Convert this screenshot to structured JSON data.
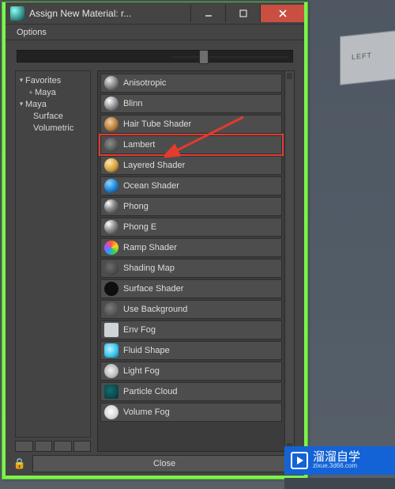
{
  "titlebar": {
    "title": "Assign New Material: r..."
  },
  "menubar": {
    "options": "Options"
  },
  "tree": {
    "favorites": "Favorites",
    "add_maya": "Maya",
    "maya": "Maya",
    "surface": "Surface",
    "volumetric": "Volumetric"
  },
  "materials": [
    {
      "id": "anisotropic",
      "label": "Anisotropic",
      "icon": "ico-aniso"
    },
    {
      "id": "blinn",
      "label": "Blinn",
      "icon": "ico-blinn"
    },
    {
      "id": "hair-tube-shader",
      "label": "Hair Tube Shader",
      "icon": "ico-hair"
    },
    {
      "id": "lambert",
      "label": "Lambert",
      "icon": "ico-lambert",
      "highlight": true
    },
    {
      "id": "layered-shader",
      "label": "Layered Shader",
      "icon": "ico-layer"
    },
    {
      "id": "ocean-shader",
      "label": "Ocean Shader",
      "icon": "ico-ocean"
    },
    {
      "id": "phong",
      "label": "Phong",
      "icon": "ico-phong"
    },
    {
      "id": "phong-e",
      "label": "Phong E",
      "icon": "ico-phonge"
    },
    {
      "id": "ramp-shader",
      "label": "Ramp Shader",
      "icon": "ico-ramp"
    },
    {
      "id": "shading-map",
      "label": "Shading Map",
      "icon": "ico-shmap"
    },
    {
      "id": "surface-shader",
      "label": "Surface Shader",
      "icon": "ico-surf"
    },
    {
      "id": "use-background",
      "label": "Use Background",
      "icon": "ico-usebg"
    },
    {
      "id": "env-fog",
      "label": "Env Fog",
      "icon": "ico-envfog"
    },
    {
      "id": "fluid-shape",
      "label": "Fluid Shape",
      "icon": "ico-fluid"
    },
    {
      "id": "light-fog",
      "label": "Light Fog",
      "icon": "ico-lightfog"
    },
    {
      "id": "particle-cloud",
      "label": "Particle Cloud",
      "icon": "ico-particle"
    },
    {
      "id": "volume-fog",
      "label": "Volume Fog",
      "icon": "ico-volfog"
    }
  ],
  "footer": {
    "close": "Close"
  },
  "watermark": {
    "text": "溜溜自学",
    "sub": "zixue.3d66.com"
  },
  "viewport": {
    "box_label": "LEFT"
  }
}
